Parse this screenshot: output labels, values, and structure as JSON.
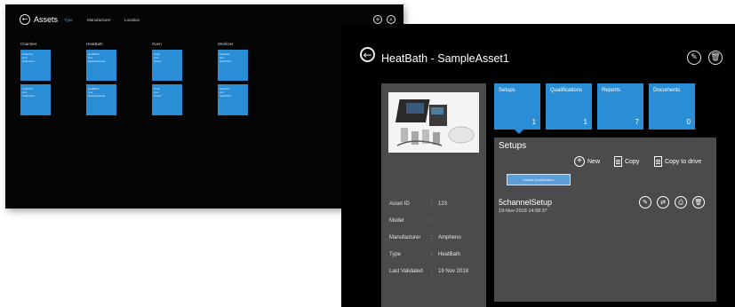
{
  "back_window": {
    "title": "Assets",
    "tabs": [
      {
        "label": "Type",
        "active": true
      },
      {
        "label": "Manufacturer",
        "active": false
      },
      {
        "label": "Location",
        "active": false
      }
    ],
    "columns": [
      {
        "header": "Chamber",
        "tiles": [
          [
            "Chamber",
            "Amr",
            "Chamber1"
          ],
          [
            "Chamber",
            "Amr",
            "Chamber2"
          ]
        ]
      },
      {
        "header": "HeatBath",
        "tiles": [
          [
            "HeatBath",
            "Amr",
            "SampleAsset1"
          ],
          [
            "HeatBath",
            "Amr",
            "SampleAsset2"
          ]
        ]
      },
      {
        "header": "Oven",
        "tiles": [
          [
            "Oven",
            "Amr",
            "Oven1"
          ],
          [
            "Oven",
            "Amr",
            "Oven2"
          ]
        ]
      },
      {
        "header": "Sterilizer",
        "tiles": [
          [
            "Sterilizer",
            "Amr",
            "Sterilizer1"
          ],
          [
            "Sterilizer",
            "Amr",
            "Sterilizer2"
          ]
        ]
      }
    ]
  },
  "front_window": {
    "title": "HeatBath - SampleAsset1",
    "info": [
      {
        "label": "Asset ID",
        "value": "123"
      },
      {
        "label": "Model",
        "value": ""
      },
      {
        "label": "Manufacturer",
        "value": "Ampheno"
      },
      {
        "label": "Type",
        "value": "HeatBath"
      },
      {
        "label": "Last Validated",
        "value": "19 Nov 2018"
      }
    ],
    "separator": ":",
    "tiles": [
      {
        "label": "Setups",
        "count": "1"
      },
      {
        "label": "Qualifications",
        "count": "1"
      },
      {
        "label": "Reports",
        "count": "7"
      },
      {
        "label": "Documents",
        "count": "0"
      }
    ],
    "setups": {
      "heading": "Setups",
      "new_label": "New",
      "copy_label": "Copy",
      "copy_to_drive_label": "Copy to drive",
      "qualification_chip": "Initiate Qualification",
      "setup_name": "5channelSetup",
      "setup_date": "19-Nov-2018 14:58:37"
    }
  },
  "accent_color": "#2a8ed6"
}
